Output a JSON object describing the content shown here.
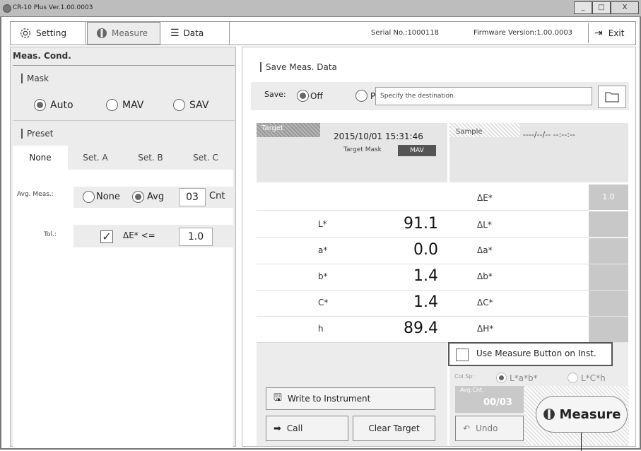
{
  "window": {
    "title": "CR-10 Plus Ver.1.00.0003",
    "buttons": [
      "_",
      "□",
      "X"
    ]
  },
  "toolbar": {
    "setting_label": "Setting",
    "measure_label": "Measure",
    "data_label": "Data",
    "serial": "Serial No.:1000118",
    "firmware": "Firmware Version:1.00.0003",
    "exit_label": "Exit"
  },
  "meas_cond": {
    "title": "Meas. Cond.",
    "mask": {
      "title": "Mask",
      "options": [
        "Auto",
        "MAV",
        "SAV"
      ],
      "selected": "Auto"
    },
    "preset": {
      "title": "Preset",
      "tabs": [
        "None",
        "Set. A",
        "Set. B",
        "Set. C"
      ],
      "active": "None"
    },
    "avg_meas": {
      "label": "Avg. Meas.:",
      "options": [
        "None",
        "Avg"
      ],
      "selected": "Avg",
      "count": "03",
      "unit": "Cnt"
    },
    "tol": {
      "label": "Tol.:",
      "checked": true,
      "criterion": "ΔE* <=",
      "value": "1.0"
    }
  },
  "save": {
    "title": "Save Meas. Data",
    "label": "Save:",
    "options": [
      "Off",
      "PC"
    ],
    "selected": "Off",
    "destination_placeholder": "Specify the destination."
  },
  "target": {
    "title": "Target",
    "datetime": "2015/10/01 15:31:46",
    "mask_label": "Target Mask",
    "mask_value": "MAV"
  },
  "sample": {
    "title": "Sample",
    "datetime": "----/--/-- --:--:--"
  },
  "values": {
    "rows": [
      {
        "label": "L*",
        "value": "91.1",
        "delta_label": "ΔL*"
      },
      {
        "label": "a*",
        "value": "0.0",
        "delta_label": "Δa*"
      },
      {
        "label": "b*",
        "value": "1.4",
        "delta_label": "Δb*"
      },
      {
        "label": "C*",
        "value": "1.4",
        "delta_label": "ΔC*"
      },
      {
        "label": "h",
        "value": "89.4",
        "delta_label": "ΔH*"
      }
    ],
    "delta_e_label": "ΔE*",
    "delta_e_threshold": "1.0"
  },
  "actions": {
    "write_label": "Write to Instrument",
    "call_label": "Call",
    "clear_label": "Clear Target",
    "use_button_label": "Use Measure Button on Inst.",
    "col_sp_label": "Col.Sp:",
    "col_sp_options": [
      "L*a*b*",
      "L*C*h"
    ],
    "col_sp_selected": "L*a*b*",
    "avg_cnt_label": "Avg.Cnt.",
    "avg_cnt_value": "00/03",
    "undo_label": "Undo",
    "measure_label": "Measure"
  }
}
